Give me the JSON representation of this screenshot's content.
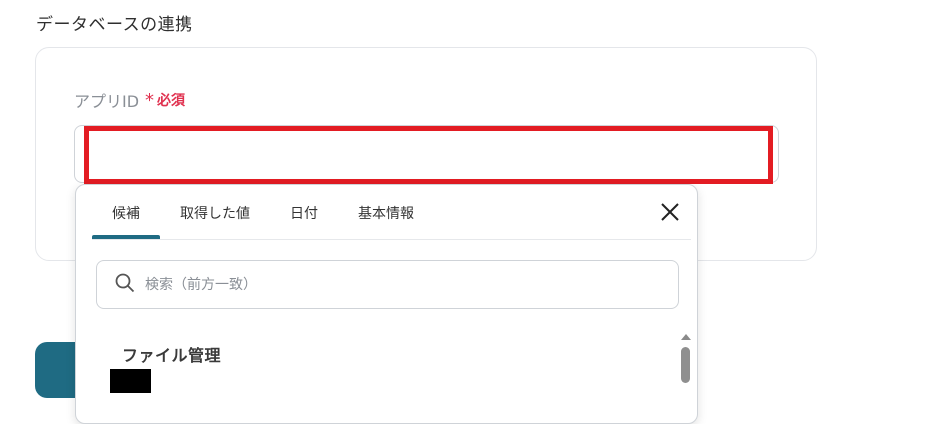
{
  "section": {
    "title": "データベースの連携"
  },
  "field": {
    "label": "アプリID",
    "required_mark": "*",
    "required_text": "必須",
    "value": ""
  },
  "dropdown": {
    "tabs": [
      {
        "label": "候補",
        "active": true
      },
      {
        "label": "取得した値",
        "active": false
      },
      {
        "label": "日付",
        "active": false
      },
      {
        "label": "基本情報",
        "active": false
      }
    ],
    "search": {
      "placeholder": "検索（前方一致）"
    },
    "group_label": "ファイル管理"
  },
  "colors": {
    "accent": "#1f6b83",
    "required": "#e0314f",
    "highlight": "#e31c23"
  }
}
